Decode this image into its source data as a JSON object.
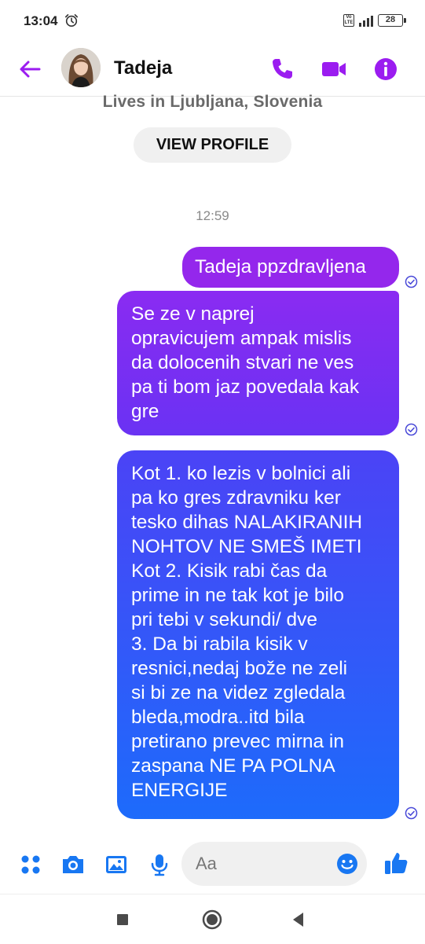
{
  "status_bar": {
    "time": "13:04",
    "volte": "VoLTE",
    "network": "4G",
    "battery": "28"
  },
  "header": {
    "name": "Tadeja",
    "accent": "#9b1cf0"
  },
  "profile": {
    "lives_in": "Lives in Ljubljana, Slovenia",
    "view_profile": "VIEW PROFILE"
  },
  "conversation": {
    "timestamp": "12:59",
    "messages": [
      {
        "text": "Tadeja ppzdravljena",
        "status": "sent"
      },
      {
        "text": "Se ze v naprej\nopravicujem ampak mislis\nda dolocenih stvari ne ves\npa ti bom jaz povedala kak\ngre",
        "status": "sent"
      },
      {
        "text": "Kot 1. ko lezis v bolnici ali\npa ko gres zdravniku ker\ntesko dihas NALAKIRANIH\nNOHTOV NE SMEŠ IMETI\nKot 2. Kisik rabi čas da\nprime in ne tak kot je bilo\npri tebi v sekundi/ dve\n3. Da bi rabila kisik v\nresnici,nedaj bože ne zeli\nsi bi ze na videz zgledala\nbleda,modra..itd bila\npretirano prevec mirna in\nzaspana NE PA POLNA\nENERGIJE",
        "status": "sent"
      }
    ]
  },
  "composer": {
    "placeholder": "Aa",
    "accent": "#1877f2"
  }
}
